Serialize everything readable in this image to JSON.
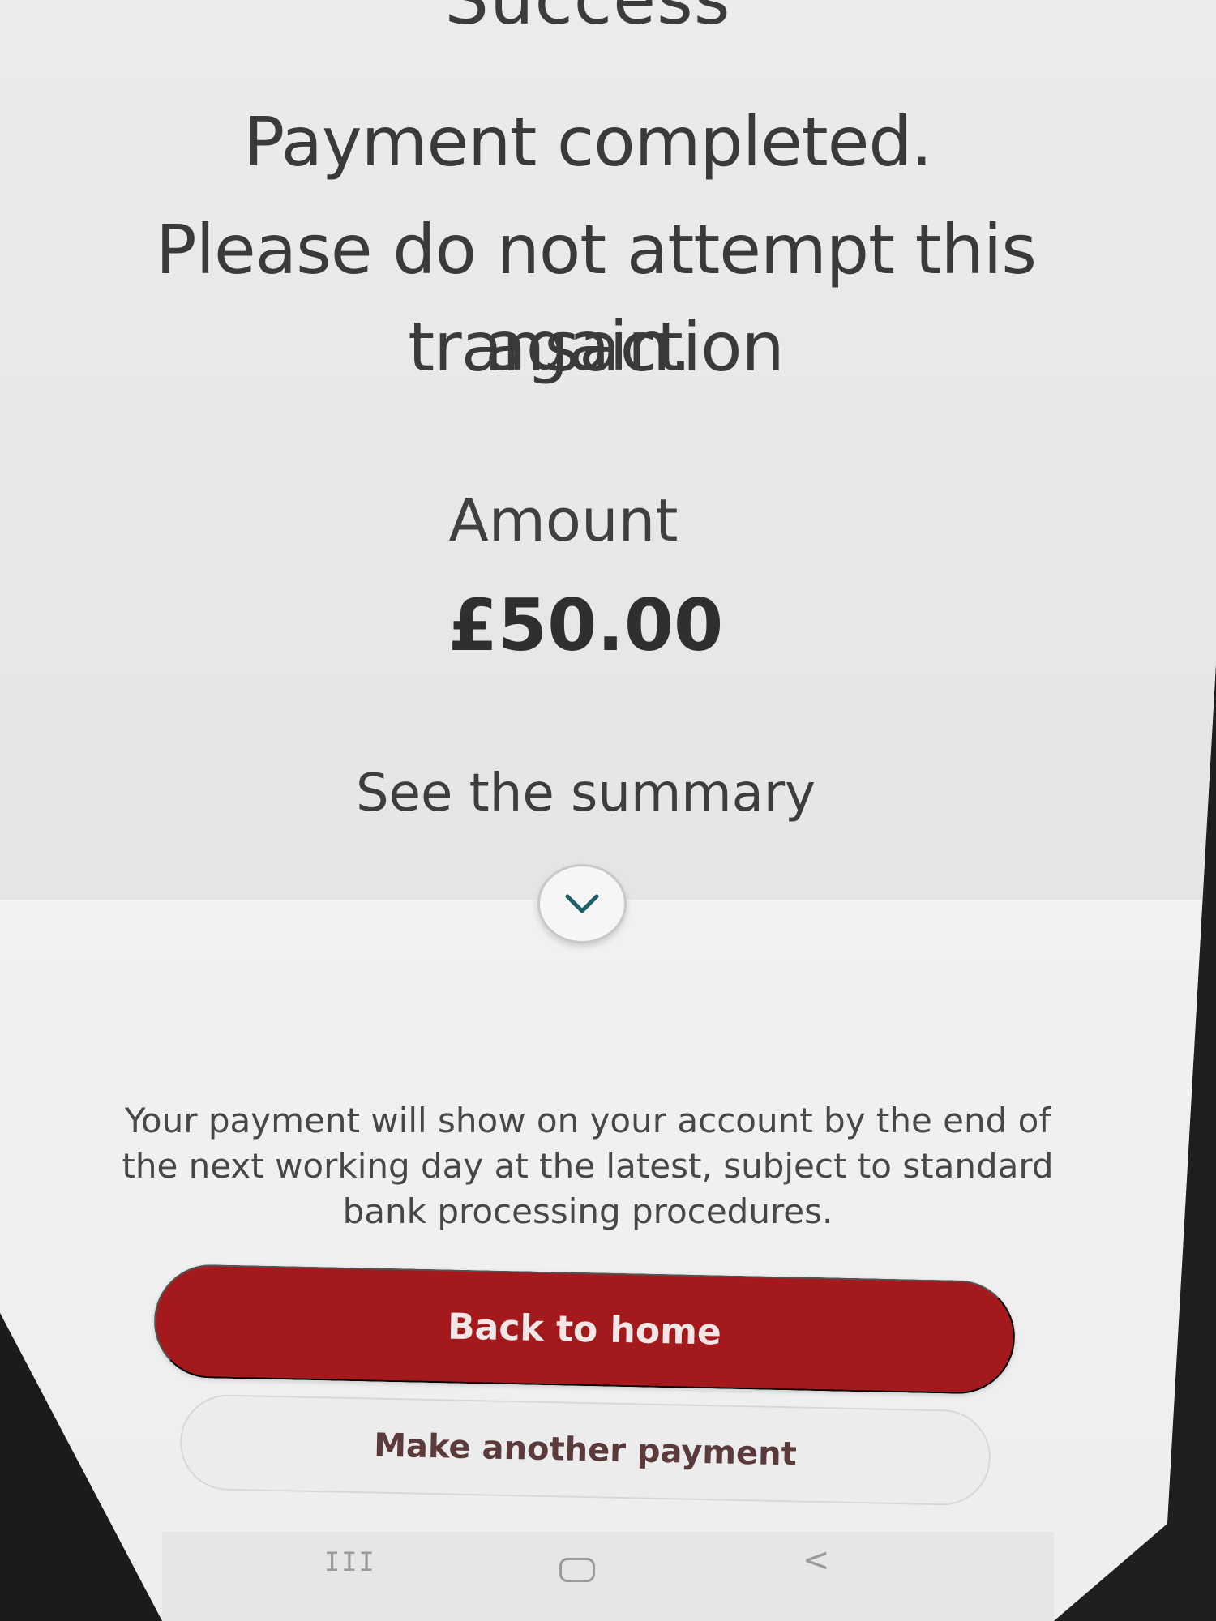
{
  "status": {
    "title": "Success"
  },
  "message": {
    "line1": "Payment completed.",
    "line2": "Please do not attempt this transaction",
    "line3": "again."
  },
  "amount": {
    "label": "Amount",
    "value": "£50.00"
  },
  "summary": {
    "link_label": "See the summary",
    "toggle_icon": "chevron-down-icon"
  },
  "info": {
    "text": "Your payment will show on your account by the end of the next working day at the latest, subject to standard bank processing procedures."
  },
  "actions": {
    "primary_label": "Back to home",
    "secondary_label": "Make another payment"
  },
  "navbar": {
    "recent_icon": "recent-apps-icon",
    "home_icon": "home-icon",
    "back_icon": "back-icon",
    "recent_glyph": "III",
    "back_glyph": "<"
  },
  "colors": {
    "primary_button": "#a41a1c",
    "chevron": "#1f5d6b",
    "text": "#3a3a3c"
  }
}
